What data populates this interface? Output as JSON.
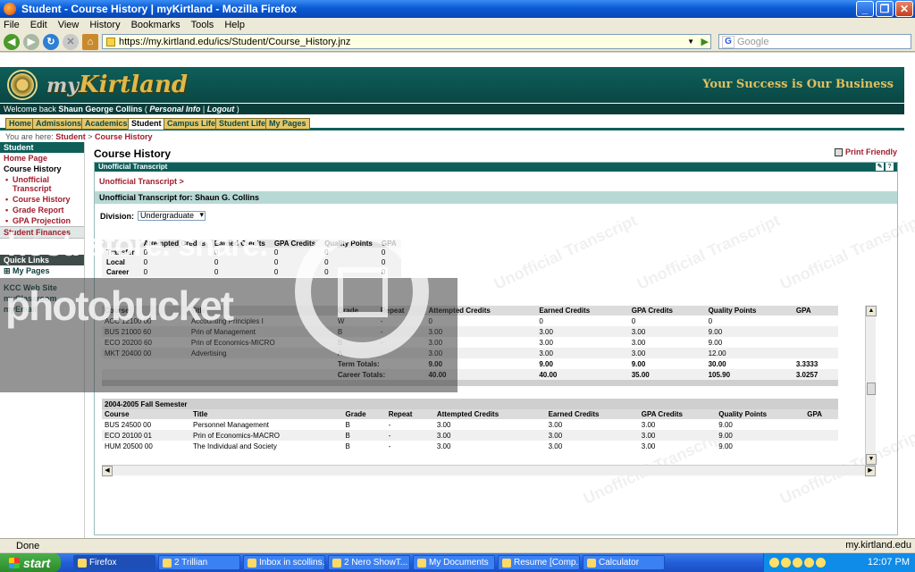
{
  "window": {
    "title": "Student - Course History | myKirtland - Mozilla Firefox"
  },
  "menu": [
    "File",
    "Edit",
    "View",
    "History",
    "Bookmarks",
    "Tools",
    "Help"
  ],
  "nav": {
    "url": "https://my.kirtland.edu/ics/Student/Course_History.jnz",
    "search_placeholder": "Google"
  },
  "site": {
    "brand_my": "my",
    "brand_name": "Kirtland",
    "tagline": "Your Success is Our Business",
    "welcome_prefix": "Welcome back",
    "user": "Shaun George Collins",
    "personal_info": "Personal Info",
    "logout": "Logout"
  },
  "tabs": [
    "Home",
    "Admissions",
    "Academics",
    "Student",
    "Campus Life",
    "Student Life",
    "My Pages"
  ],
  "breadcrumb": {
    "prefix": "You are here:",
    "level1": "Student",
    "sep": ">",
    "level2": "Course History"
  },
  "sidebar": {
    "header": "Student",
    "home": "Home Page",
    "current": "Course History",
    "subs": [
      "Unofficial Transcript",
      "Course History",
      "Grade Report",
      "GPA Projection"
    ],
    "finances": "Student Finances",
    "quick_links": "Quick Links",
    "my_pages": "My Pages",
    "links": [
      "KCC Web Site",
      "myClassroom",
      "myEmail"
    ]
  },
  "main": {
    "title": "Course History",
    "print": "Print Friendly",
    "portlet_title": "Unofficial Transcript",
    "crumb": "Unofficial Transcript >",
    "for_label": "Unofficial Transcript for: Shaun G. Collins",
    "division_label": "Division:",
    "division_value": "Undergraduate",
    "watermark": "Unofficial Transcript"
  },
  "summary": {
    "headers": [
      "",
      "Attempted Credits",
      "Earned Credits",
      "GPA Credits",
      "Quality Points",
      "GPA"
    ],
    "rows": [
      {
        "label": "Transfer",
        "v": [
          "0",
          "0",
          "0",
          "0",
          "0"
        ]
      },
      {
        "label": "Local",
        "v": [
          "0",
          "0",
          "0",
          "0",
          "0"
        ]
      },
      {
        "label": "Career",
        "v": [
          "0",
          "0",
          "0",
          "0",
          "0"
        ]
      }
    ]
  },
  "grid_headers": [
    "Course",
    "Title",
    "Grade",
    "Repeat",
    "Attempted Credits",
    "Earned Credits",
    "GPA Credits",
    "Quality Points",
    "GPA"
  ],
  "term1": {
    "rows": [
      [
        "ACC 12100 00",
        "Accounting Principles I",
        "W",
        "-",
        "0",
        "0",
        "0",
        "0",
        ""
      ],
      [
        "BUS 21000 60",
        "Prin of Management",
        "B",
        "-",
        "3.00",
        "3.00",
        "3.00",
        "9.00",
        ""
      ],
      [
        "ECO 20200 60",
        "Prin of Economics-MICRO",
        "B",
        "-",
        "3.00",
        "3.00",
        "3.00",
        "9.00",
        ""
      ],
      [
        "MKT 20400 00",
        "Advertising",
        "A",
        "-",
        "3.00",
        "3.00",
        "3.00",
        "12.00",
        ""
      ]
    ],
    "term_totals": [
      "Term Totals:",
      "9.00",
      "9.00",
      "9.00",
      "30.00",
      "3.3333"
    ],
    "career_totals": [
      "Career Totals:",
      "40.00",
      "40.00",
      "35.00",
      "105.90",
      "3.0257"
    ]
  },
  "term2": {
    "name": "2004-2005 Fall Semester",
    "rows": [
      [
        "BUS 24500 00",
        "Personnel Management",
        "B",
        "-",
        "3.00",
        "3.00",
        "3.00",
        "9.00",
        ""
      ],
      [
        "ECO 20100 01",
        "Prin of Economics-MACRO",
        "B",
        "-",
        "3.00",
        "3.00",
        "3.00",
        "9.00",
        ""
      ],
      [
        "HUM 20500 00",
        "The Individual and Society",
        "B",
        "-",
        "3.00",
        "3.00",
        "3.00",
        "9.00",
        ""
      ]
    ]
  },
  "overlay": {
    "line1": "host. store. share.",
    "line2": "photobucket"
  },
  "status": {
    "text": "Done",
    "domain": "my.kirtland.edu"
  },
  "taskbar": {
    "start": "start",
    "tasks": [
      "Firefox",
      "2 Trillian",
      "Inbox in scollins...",
      "2 Nero ShowT...",
      "My Documents",
      "Resume [Comp...",
      "Calculator"
    ],
    "clock": "12:07 PM"
  }
}
